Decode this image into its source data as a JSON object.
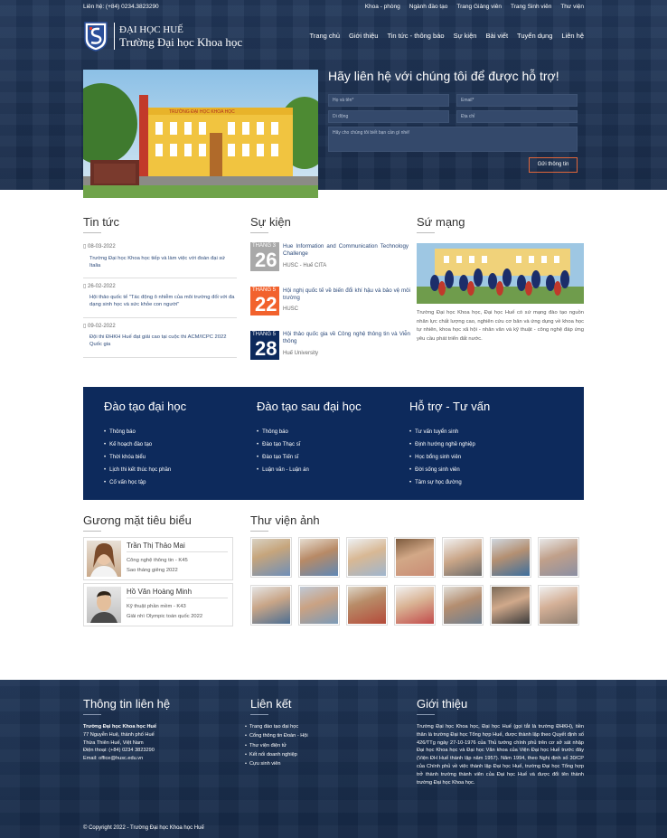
{
  "topbar": {
    "phone": "Liên hệ: (+84) 0234.3823290",
    "links": [
      "Khoa - phòng",
      "Ngành đào tạo",
      "Trang Giảng viên",
      "Trang Sinh viên",
      "Thư viện"
    ]
  },
  "logo": {
    "line1": "ĐẠI HỌC HUẾ",
    "line2": "Trường Đại học Khoa học"
  },
  "nav": [
    "Trang chủ",
    "Giới thiệu",
    "Tin tức - thông báo",
    "Sự kiện",
    "Bài viết",
    "Tuyển dụng",
    "Liên hệ"
  ],
  "hero": {
    "image_caption": "TRƯỜNG ĐẠI HỌC KHOA HỌC",
    "contact_title": "Hãy liên hệ với chúng tôi để được hỗ trợ!",
    "name_placeholder": "Họ và tên*",
    "email_placeholder": "Email*",
    "phone_placeholder": "Di động",
    "address_placeholder": "Địa chỉ",
    "message_placeholder": "Hãy cho chúng tôi biết bạn cần gì nhé!",
    "send_label": "Gửi thông tin"
  },
  "news": {
    "title": "Tin tức",
    "items": [
      {
        "date": "08-03-2022",
        "text": "Trường Đại học Khoa học tiếp và làm việc với đoàn đại sứ Italia"
      },
      {
        "date": "26-02-2022",
        "text": "Hội thảo quốc tế \"Tác động ô nhiễm của môi trường đối với đa dạng sinh học và sức khỏe con người\""
      },
      {
        "date": "09-02-2022",
        "text": "Đội thi ĐHKH Huế đạt giải cao tại cuộc thi ACM/ICPC 2022 Quốc gia"
      }
    ]
  },
  "events": {
    "title": "Sự kiện",
    "items": [
      {
        "month": "THÁNG 3",
        "day": "26",
        "title": "Hue Information and Communication Technology Challenge",
        "org": "HUSC - Huế CITA",
        "color": "#a9a9a9"
      },
      {
        "month": "THÁNG 5",
        "day": "22",
        "title": "Hội nghị quốc tế về biến đổi khí hậu và bảo vệ môi trường",
        "org": "HUSC",
        "color": "#f2622d"
      },
      {
        "month": "THÁNG 5",
        "day": "28",
        "title": "Hội thảo quốc gia về Công nghệ thông tin và Viễn thông",
        "org": "Huế University",
        "color": "#0d2a5c"
      }
    ]
  },
  "mission": {
    "title": "Sứ mạng",
    "text": "Trường Đại học Khoa học, Đại học Huế có sứ mạng đào tạo nguồn nhân lực chất lượng cao, nghiên cứu cơ bản và ứng dụng về khoa học tự nhiên, khoa học xã hội - nhân văn và kỹ thuật - công nghệ đáp ứng yêu cầu phát triển đất nước."
  },
  "programs": [
    {
      "title": "Đào tạo đại học",
      "items": [
        "Thông báo",
        "Kế hoạch đào tạo",
        "Thời khóa biểu",
        "Lịch thi kết thúc học phần",
        "Cố vấn học tập"
      ]
    },
    {
      "title": "Đào tạo sau đại học",
      "items": [
        "Thông báo",
        "Đào tạo Thạc sĩ",
        "Đào tạo Tiến sĩ",
        "Luận văn - Luận án"
      ]
    },
    {
      "title": "Hỗ trợ - Tư vấn",
      "items": [
        "Tư vấn tuyển sinh",
        "Định hướng nghề nghiệp",
        "Học bổng sinh viên",
        "Đời sống sinh viên",
        "Tâm sự học đường"
      ]
    }
  ],
  "faces": {
    "title": "Gương mặt tiêu biểu",
    "items": [
      {
        "name": "Trần Thị Thảo Mai",
        "line1": "Công nghệ thông tin - K45",
        "line2": "Sao tháng giêng 2022"
      },
      {
        "name": "Hồ Văn Hoàng Minh",
        "line1": "Kỹ thuật phần mềm - K43",
        "line2": "Giải nhì Olympic toán quốc 2022"
      }
    ]
  },
  "gallery": {
    "title": "Thư viện ảnh"
  },
  "footer": {
    "contact_title": "Thông tin liên hệ",
    "school": "Trường Đại học Khoa học Huế",
    "addr1": "77 Nguyễn Huệ, thành phố Huế",
    "addr2": "Thừa Thiên Huế, Việt Nam",
    "phone": "Điện thoại: (+84) 0234 3823290",
    "email": "Email: office@husc.edu.vn",
    "links_title": "Liên kết",
    "links": [
      "Trang đào tạo đại học",
      "Cổng thông tin Đoàn - Hội",
      "Thư viện điện tử",
      "Kết nối doanh nghiệp",
      "Cựu sinh viên"
    ],
    "about_title": "Giới thiệu",
    "about_text": "Trường Đại học Khoa học, Đại học Huế (gọi tắt là trường ĐHKH), tiền thân là trường Đại học Tổng hợp Huế, được thành lập theo Quyết định số 426/TTg ngày 27-10-1976 của Thủ tướng chính phủ trên cơ sở sát nhập Đại học Khoa học và Đại học Văn khoa của Viện Đại học Huế trước đây (Viện ĐH Huế thành lập năm 1957). Năm 1994, theo Nghị định số 30/CP của Chính phủ về việc thành lập Đại học Huế, trường Đại học Tổng hợp trở thành trường thành viên của Đại học Huế và được đổi tên thành trường Đại học Khoa học.",
    "copyright": "© Copyright 2022 - Trường Đại học Khoa học Huế"
  }
}
